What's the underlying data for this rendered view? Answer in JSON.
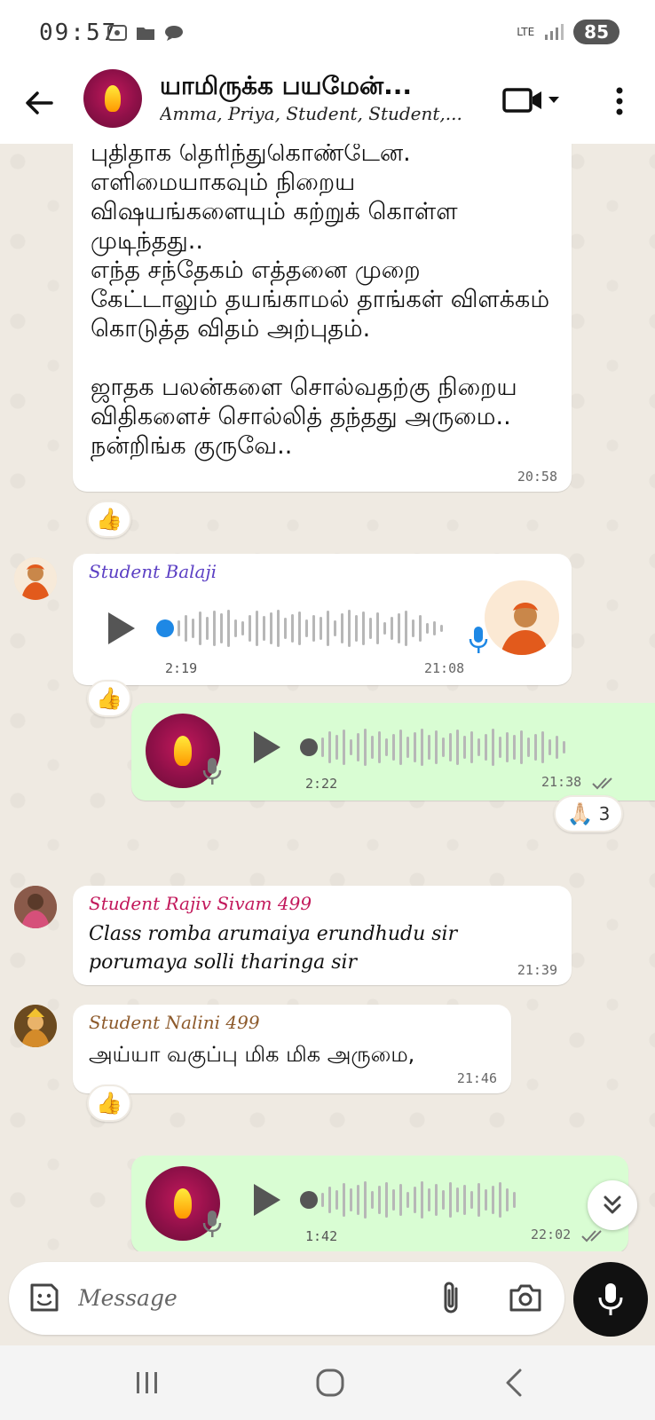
{
  "status_bar": {
    "time": "09:57",
    "network": "LTE",
    "battery": "85"
  },
  "header": {
    "title": "யாமிருக்க பயமேன்...",
    "subtitle": "Amma, Priya, Student, Student,..."
  },
  "messages": {
    "m1": {
      "text": "புதிதாக தெரிந்துகொண்டேன.\nஎளிமையாகவும் நிறைய விஷயங்களையும் கற்றுக் கொள்ள முடிந்தது..\nஎந்த சந்தேகம் எத்தனை முறை கேட்டாலும் தயங்காமல்  தாங்கள் விளக்கம் கொடுத்த விதம் அற்புதம்.\n\nஜாதக பலன்களை சொல்வதற்கு நிறைய விதிகளைச் சொல்லித் தந்தது அருமை..\nநன்றிங்க குருவே..",
      "time": "20:58",
      "reaction": "👍"
    },
    "m2": {
      "sender": "Student Balaji",
      "duration": "2:19",
      "time": "21:08",
      "reaction": "👍"
    },
    "m3": {
      "duration": "2:22",
      "time": "21:38",
      "reaction": "🙏🏻",
      "reaction_count": "3"
    },
    "m4": {
      "sender": "Student Rajiv Sivam 499",
      "line1": "Class romba arumaiya erundhudu sir",
      "line2": "porumaya solli tharinga sir",
      "time": "21:39"
    },
    "m5": {
      "sender": "Student Nalini 499",
      "text": "அய்யா வகுப்பு மிக மிக அருமை,",
      "time": "21:46",
      "reaction": "👍"
    },
    "m6": {
      "duration": "1:42",
      "time": "22:02"
    }
  },
  "composer": {
    "placeholder": "Message"
  },
  "colors": {
    "chat_bg": "#efeae2",
    "outgoing_bubble": "#d9fdd3",
    "incoming_bubble": "#ffffff",
    "sender_balaji": "#5b3fc4",
    "sender_rajiv": "#c2185b",
    "sender_nalini": "#8d5a2b",
    "voice_dot": "#1e88e5"
  }
}
